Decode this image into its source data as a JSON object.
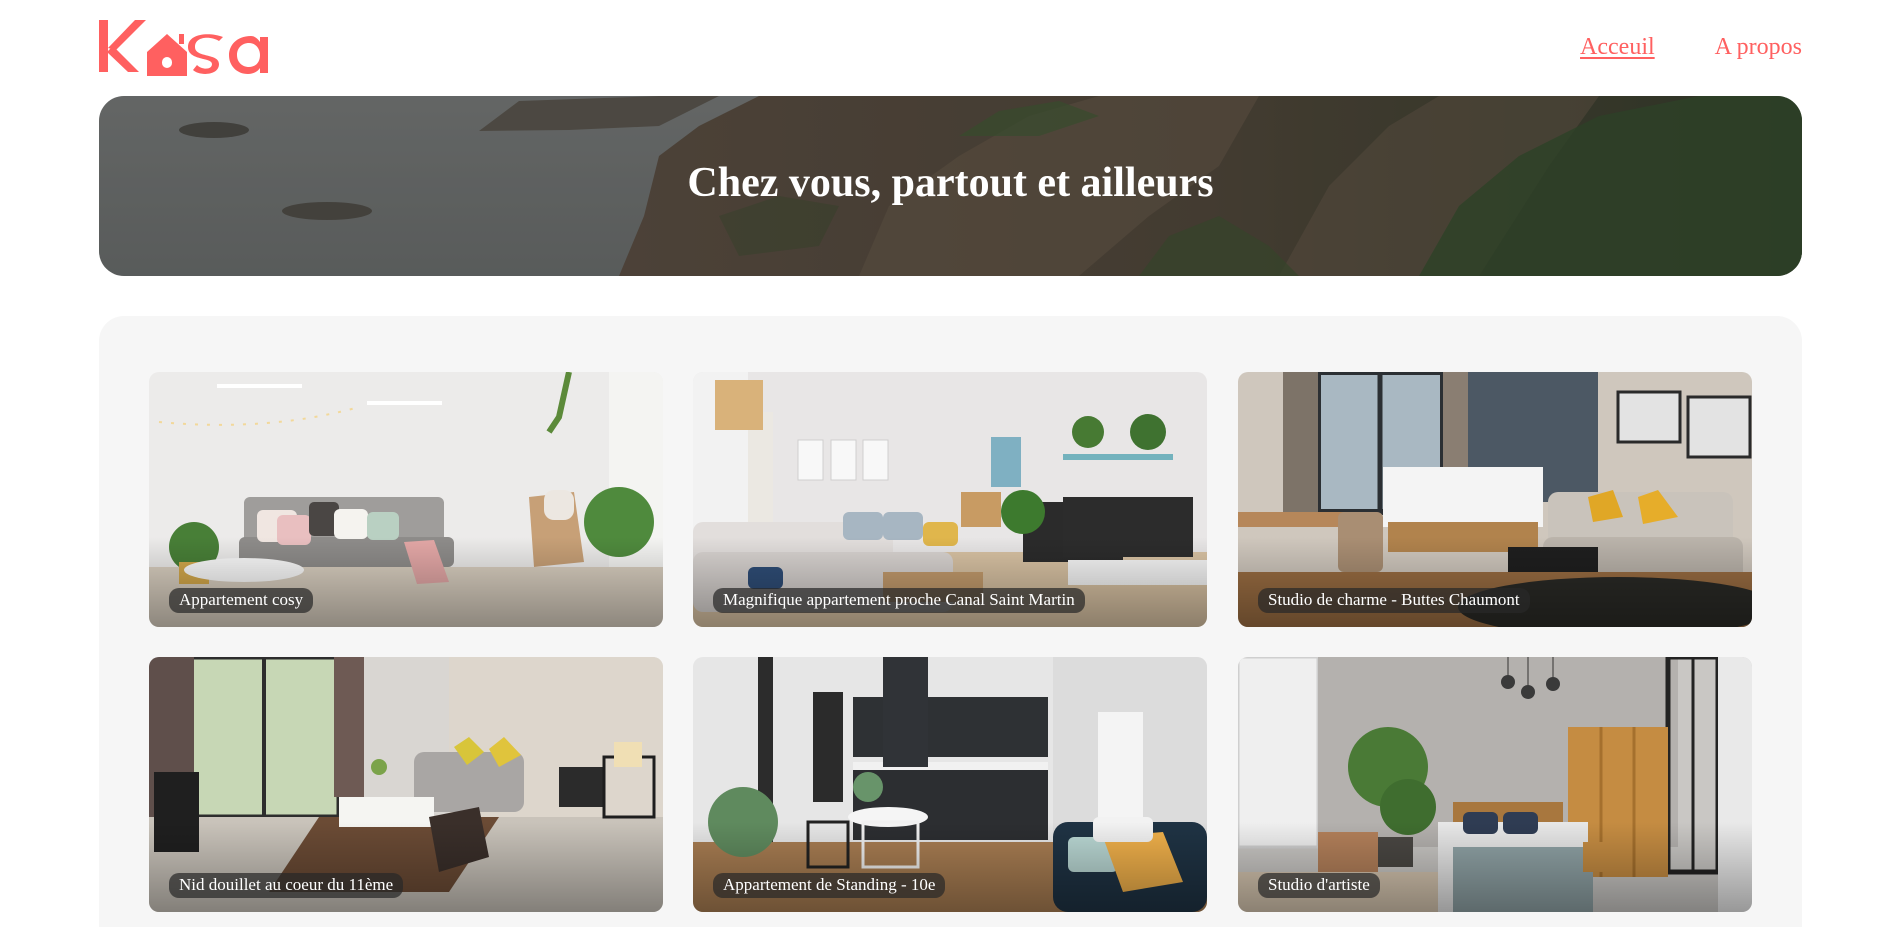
{
  "header": {
    "logo_text": "Kasa",
    "nav": [
      {
        "label": "Acceuil",
        "active": true
      },
      {
        "label": "A propos",
        "active": false
      }
    ]
  },
  "banner": {
    "title": "Chez vous, partout et ailleurs"
  },
  "listings": [
    {
      "title": "Appartement cosy"
    },
    {
      "title": "Magnifique appartement proche Canal Saint Martin"
    },
    {
      "title": "Studio de charme - Buttes Chaumont"
    },
    {
      "title": "Nid douillet au coeur du 11ème"
    },
    {
      "title": "Appartement de Standing - 10e"
    },
    {
      "title": "Studio d'artiste"
    }
  ],
  "colors": {
    "brand": "#FF6060",
    "gallery_bg": "#F6F6F6"
  }
}
